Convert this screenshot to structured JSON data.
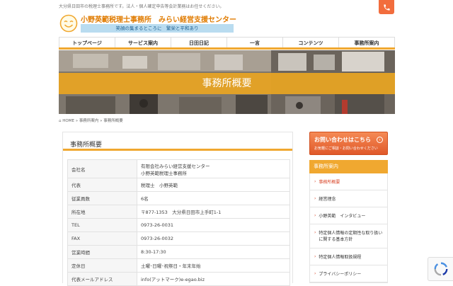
{
  "header": {
    "tagline": "大分県日田市の税理士事務所です。法人・個人確定申告等会計業務はお任せください。",
    "title": "小野英範税理士事務所　みらい経営支援センター",
    "motto": "笑顔の集まるところに　繁栄と平和あり",
    "phone_icon": "phone-icon",
    "accent": "#f0a830",
    "title_color": "#e07b00"
  },
  "nav": [
    "トップページ",
    "サービス案内",
    "日田日記",
    "一言",
    "コンテンツ",
    "事務所案内"
  ],
  "hero": {
    "title": "事務所概要"
  },
  "breadcrumb": {
    "home": "HOME",
    "sep1": "»",
    "item1": "事務所案内",
    "sep2": "»",
    "item2": "事務所概要"
  },
  "main": {
    "heading": "事務所概要",
    "rows": [
      {
        "key": "会社名",
        "value": "有限会社みらい経営支援センター",
        "value2": "小野英範税理士事務所"
      },
      {
        "key": "代表",
        "value": "税理士　小野英範"
      },
      {
        "key": "従業員数",
        "value": "6名"
      },
      {
        "key": "所在地",
        "value": "〒877-1353　大分県日田市上手町1-1"
      },
      {
        "key": "TEL",
        "value": "0973-26-0031"
      },
      {
        "key": "FAX",
        "value": "0973-26-0032"
      },
      {
        "key": "営業時間",
        "value": "8:30-17:30"
      },
      {
        "key": "定休日",
        "value": "土曜･日曜･祝祭日・年末年始"
      },
      {
        "key": "代表メールアドレス",
        "value": "info(アットマーク)e-egao.biz"
      }
    ]
  },
  "sidebar": {
    "cta_main": "お問い合わせはこちら",
    "cta_sub": "お気軽にご相談・お問い合わせください",
    "section": "事務所案内",
    "items": [
      {
        "label": "事務所概要",
        "active": true
      },
      {
        "label": "経営理念",
        "active": false
      },
      {
        "label": "小野英範　インタビュー",
        "active": false
      },
      {
        "label": "特定個人情報の定期性な取り扱いに関する基本方針",
        "active": false
      },
      {
        "label": "特定個人情報取扱規程",
        "active": false
      },
      {
        "label": "プライバシーポリシー",
        "active": false
      }
    ]
  },
  "icons": {
    "smiley": "smiley-logo-icon",
    "recaptcha": "recaptcha-icon",
    "arrow": "chevron-right-icon"
  }
}
